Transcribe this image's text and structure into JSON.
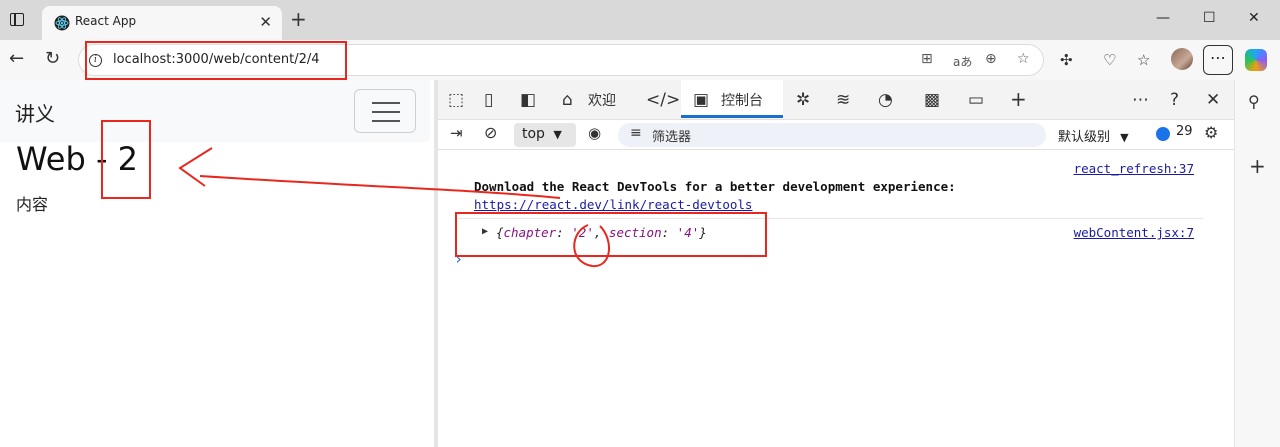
{
  "browser": {
    "tab_title": "React App",
    "url": "localhost:3000/web/content/2/4",
    "window_controls": [
      "—",
      "☐",
      "✕"
    ]
  },
  "page": {
    "brand": "讲义",
    "heading": "Web - 2",
    "content": "内容"
  },
  "devtools": {
    "tabs": {
      "welcome": "欢迎",
      "console": "控制台"
    },
    "context": "top",
    "filter_placeholder": "筛选器",
    "level": "默认级别",
    "issue_count": "29",
    "messages": {
      "devtools_msg": "Download the React DevTools for a better development experience:",
      "devtools_link": "https://react.dev/link/react-devtools",
      "devtools_source": "react_refresh:37",
      "log_source": "webContent.jsx:7",
      "log_object": {
        "open": "{",
        "key1": "chapter",
        "val1": "'2'",
        "key2": "section",
        "val2": "'4'",
        "close": "}"
      }
    }
  },
  "colors": {
    "annotation_red": "#e8281e",
    "link_blue": "#1a1aa6",
    "accent_blue": "#1a6fd1"
  }
}
